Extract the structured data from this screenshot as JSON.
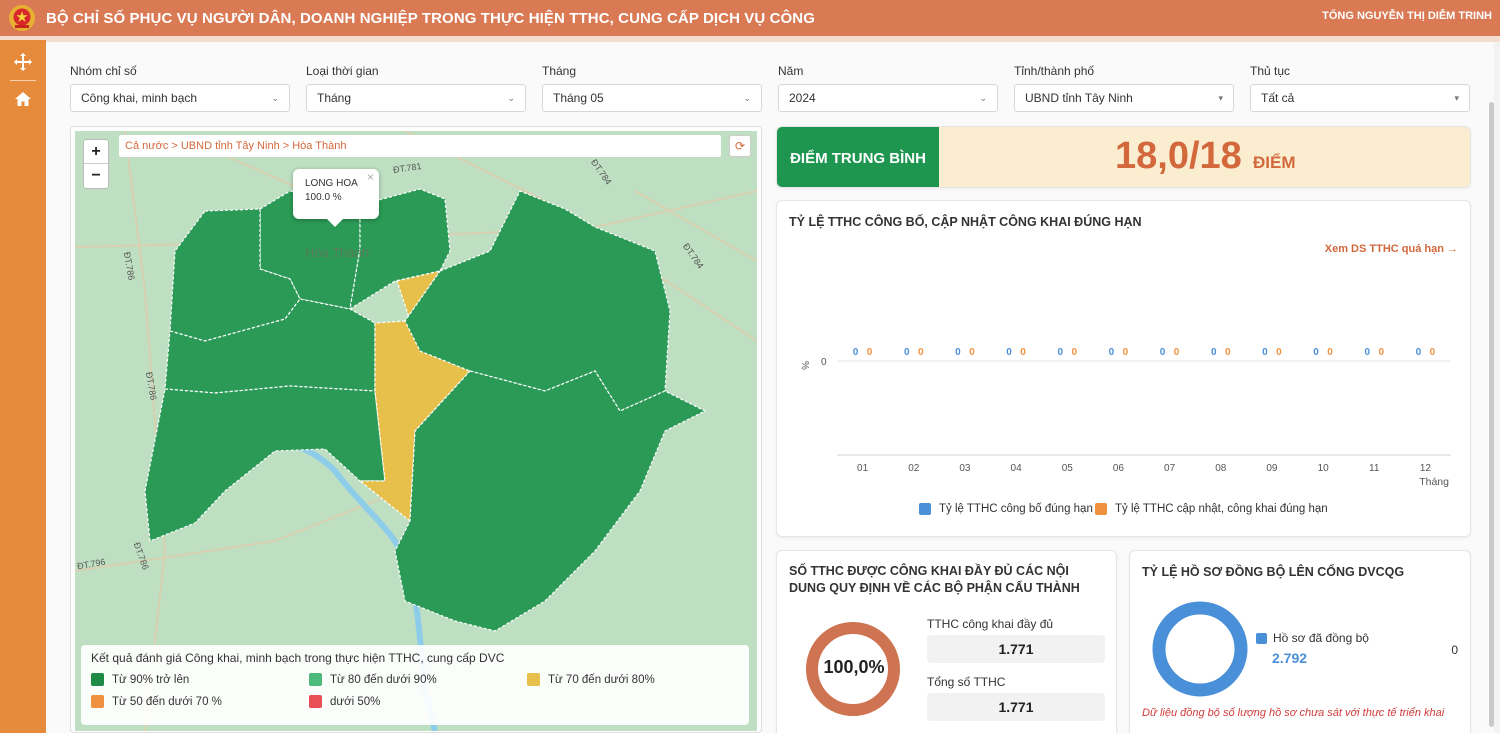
{
  "header": {
    "title": "BỘ CHỈ SỐ PHỤC VỤ NGƯỜI DÂN, DOANH NGHIỆP TRONG THỰC HIỆN TTHC, CUNG CẤP DỊCH VỤ CÔNG",
    "user": "TỔNG NGUYỄN THỊ DIỄM TRINH",
    "emblem_icon": "national-emblem",
    "colors": {
      "header": "#d97a55",
      "sidebar": "#e68a3c",
      "accent": "#d2683c",
      "green": "#1f9650"
    }
  },
  "sidebar": {
    "items": [
      {
        "icon": "move-icon"
      },
      {
        "icon": "home-icon"
      }
    ]
  },
  "filters": [
    {
      "label": "Nhóm chỉ số",
      "value": "Công khai, minh bạch"
    },
    {
      "label": "Loại thời gian",
      "value": "Tháng"
    },
    {
      "label": "Tháng",
      "value": "Tháng 05"
    },
    {
      "label": "Năm",
      "value": "2024"
    },
    {
      "label": "Tỉnh/thành phố",
      "value": "UBND tỉnh Tây Ninh"
    },
    {
      "label": "Thủ tục",
      "value": "Tất cả"
    }
  ],
  "map": {
    "breadcrumb": "Cả nước > UBND tỉnh Tây Ninh > Hòa Thành",
    "zoom_in": "+",
    "zoom_out": "−",
    "popup": {
      "name": "LONG HOA",
      "value": "100.0 %",
      "close": "×"
    },
    "place_label": "Hòa Thành",
    "road_labels": [
      "ĐT.781",
      "ĐT.784",
      "ĐT.784",
      "ĐT.786",
      "ĐT.786",
      "ĐT.786",
      "ĐT.796"
    ],
    "legend": {
      "title": "Kết quả đánh giá Công khai, minh bạch trong thực hiện TTHC, cung cấp DVC",
      "items": [
        {
          "label": "Từ 90% trở lên",
          "color": "#1e8a45"
        },
        {
          "label": "Từ 80 đến dưới 90%",
          "color": "#4cba7a"
        },
        {
          "label": "Từ 70 đến dưới 80%",
          "color": "#e6c04a"
        },
        {
          "label": "Từ 50 đến dưới 70 %",
          "color": "#ef9240"
        },
        {
          "label": "dưới 50%",
          "color": "#ea4f55"
        }
      ]
    }
  },
  "score": {
    "label": "ĐIỂM TRUNG BÌNH",
    "value": "18,0/18",
    "unit": "ĐIỂM"
  },
  "chart_card": {
    "title": "TỶ LỆ TTHC CÔNG BỐ, CẬP NHẬT CÔNG KHAI ĐÚNG HẠN",
    "link": "Xem DS TTHC quá hạn →"
  },
  "chart_data": {
    "type": "bar",
    "categories": [
      "01",
      "02",
      "03",
      "04",
      "05",
      "06",
      "07",
      "08",
      "09",
      "10",
      "11",
      "12"
    ],
    "series": [
      {
        "name": "Tỷ lệ TTHC công bố đúng hạn",
        "values": [
          0,
          0,
          0,
          0,
          0,
          0,
          0,
          0,
          0,
          0,
          0,
          0
        ],
        "color": "#4a90d9"
      },
      {
        "name": "Tỷ lệ TTHC cập nhật, công khai đúng hạn",
        "values": [
          0,
          0,
          0,
          0,
          0,
          0,
          0,
          0,
          0,
          0,
          0,
          0
        ],
        "color": "#ef9240"
      }
    ],
    "ylabel": "%",
    "xlabel": "Tháng",
    "y_tick": "0",
    "legend_position": "bottom"
  },
  "public_card": {
    "title": "SỐ TTHC ĐƯỢC CÔNG KHAI ĐẦY ĐỦ CÁC NỘI DUNG QUY ĐỊNH VỀ CÁC BỘ PHẬN CẤU THÀNH",
    "percent": "100,0%",
    "percent_value": 1.0,
    "full_label": "TTHC công khai đầy đủ",
    "full_value": "1.771",
    "total_label": "Tổng số TTHC",
    "total_value": "1.771"
  },
  "sync_card": {
    "title": "TỶ LỆ HỒ SƠ ĐỒNG BỘ LÊN CỔNG DVCQG",
    "legend_label": "Hồ sơ đã đồng bộ",
    "value": "2.792",
    "zero": "0",
    "note": "Dữ liệu đồng bộ số lượng hồ sơ chưa sát với thực tế triển khai"
  }
}
